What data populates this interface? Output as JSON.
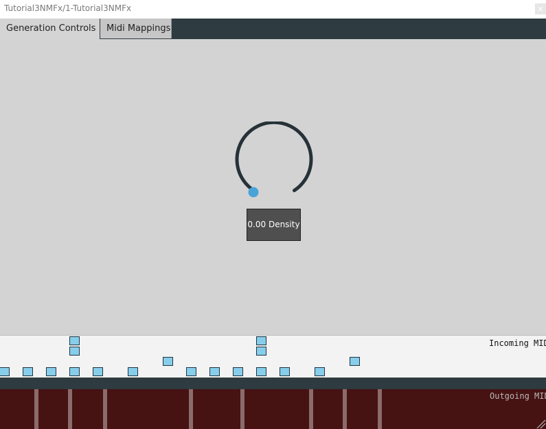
{
  "window": {
    "title": "Tutorial3NMFx/1-Tutorial3NMFx",
    "close_icon": "×"
  },
  "tabs": [
    {
      "label": "Generation Controls",
      "active": true
    },
    {
      "label": "Midi Mappings",
      "active": false
    }
  ],
  "knob": {
    "parameter": "Density",
    "value_label": "0.00 Density",
    "value": 0.0,
    "track_color": "#263238",
    "thumb_color": "#4aa3d8"
  },
  "incoming": {
    "label": "Incoming MIDI",
    "note_color": "#87ceeb"
  },
  "outgoing": {
    "label": "Outgoing MIDI",
    "background_color": "#461212"
  },
  "colors": {
    "tabbar": "#2e3b40",
    "panel": "#d3d3d3"
  }
}
